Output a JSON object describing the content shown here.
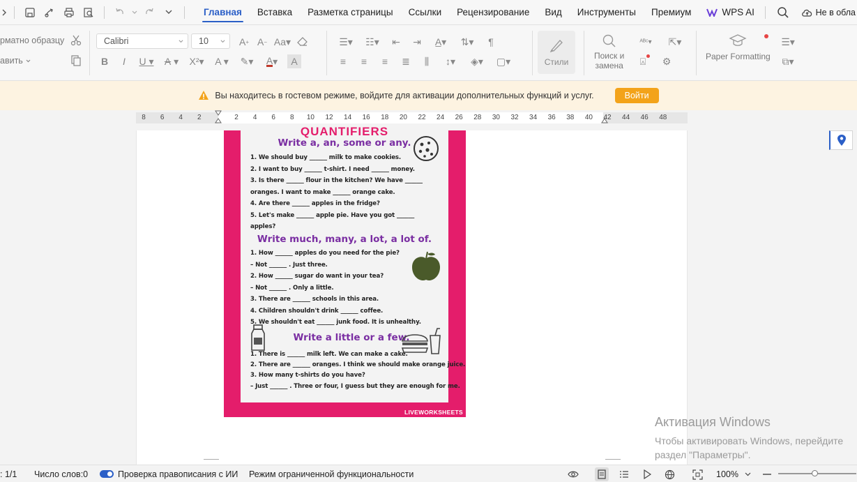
{
  "menubar": {
    "tabs": [
      {
        "label": "Главная",
        "active": true
      },
      {
        "label": "Вставка"
      },
      {
        "label": "Разметка страницы"
      },
      {
        "label": "Ссылки"
      },
      {
        "label": "Рецензирование"
      },
      {
        "label": "Вид"
      },
      {
        "label": "Инструменты"
      },
      {
        "label": "Премиум"
      },
      {
        "label": "WPS AI"
      }
    ],
    "cloud_label": "Не в обла"
  },
  "ribbon": {
    "format_painter": "рматно образцу",
    "paste_label": "авить",
    "font_name": "Calibri",
    "font_size": "10",
    "styles_label": "Стили",
    "find_label_1": "Поиск и",
    "find_label_2": "замена",
    "paper_formatting": "Paper Formatting"
  },
  "banner": {
    "message": "Вы находитесь в гостевом режиме, войдите для активации дополнительных функций и услуг.",
    "login_button": "Войти"
  },
  "ruler": {
    "ticks": [
      "8",
      "6",
      "4",
      "2",
      "",
      "2",
      "4",
      "6",
      "8",
      "10",
      "12",
      "14",
      "16",
      "18",
      "20",
      "22",
      "24",
      "26",
      "28",
      "30",
      "32",
      "34",
      "36",
      "38",
      "40",
      "42",
      "44",
      "46",
      "48"
    ]
  },
  "worksheet": {
    "title": "QUANTIFIERS",
    "section1_heading": "Write a, an, some or any.",
    "section1_lines": [
      "1. We should buy ______ milk to make cookies.",
      "2. I want to buy ______ t-shirt. I need ______ money.",
      "3. Is there ______ flour in the kitchen? We have ______",
      "oranges. I want to make ______ orange cake.",
      "4. Are there ______ apples in the fridge?",
      "5. Let's make ______ apple pie. Have you got ______",
      "apples?"
    ],
    "section2_heading": "Write much, many, a lot, a lot of.",
    "section2_lines": [
      "1. How ______ apples do you need for the pie?",
      "– Not ______ . Just three.",
      "2. How ______ sugar do want in your tea?",
      "– Not ______ . Only a little.",
      "3. There are ______ schools in this area.",
      "4. Children shouldn't drink ______ coffee.",
      "5. We shouldn't eat ______ junk food. It is unhealthy."
    ],
    "section3_heading": "Write a little or a few.",
    "section3_lines": [
      "1. There is ______ milk left. We can make a cake.",
      "2. There are ______ oranges. I think we should make orange juice.",
      "3. How many t-shirts do you have?",
      "– Just ______ . Three or four, I guess but they are enough for me."
    ],
    "footer": "LIVEWORKSHEETS",
    "colors": {
      "frame": "#e41d6b",
      "heading": "#7a2ea2"
    }
  },
  "activation": {
    "title": "Активация Windows",
    "line1": "Чтобы активировать Windows, перейдите",
    "line2": "раздел \"Параметры\"."
  },
  "status": {
    "page": ": 1/1",
    "word_count": "Число слов:0",
    "spellcheck": "Проверка правописания с ИИ",
    "mode": "Режим ограниченной функциональности",
    "zoom": "100%"
  }
}
